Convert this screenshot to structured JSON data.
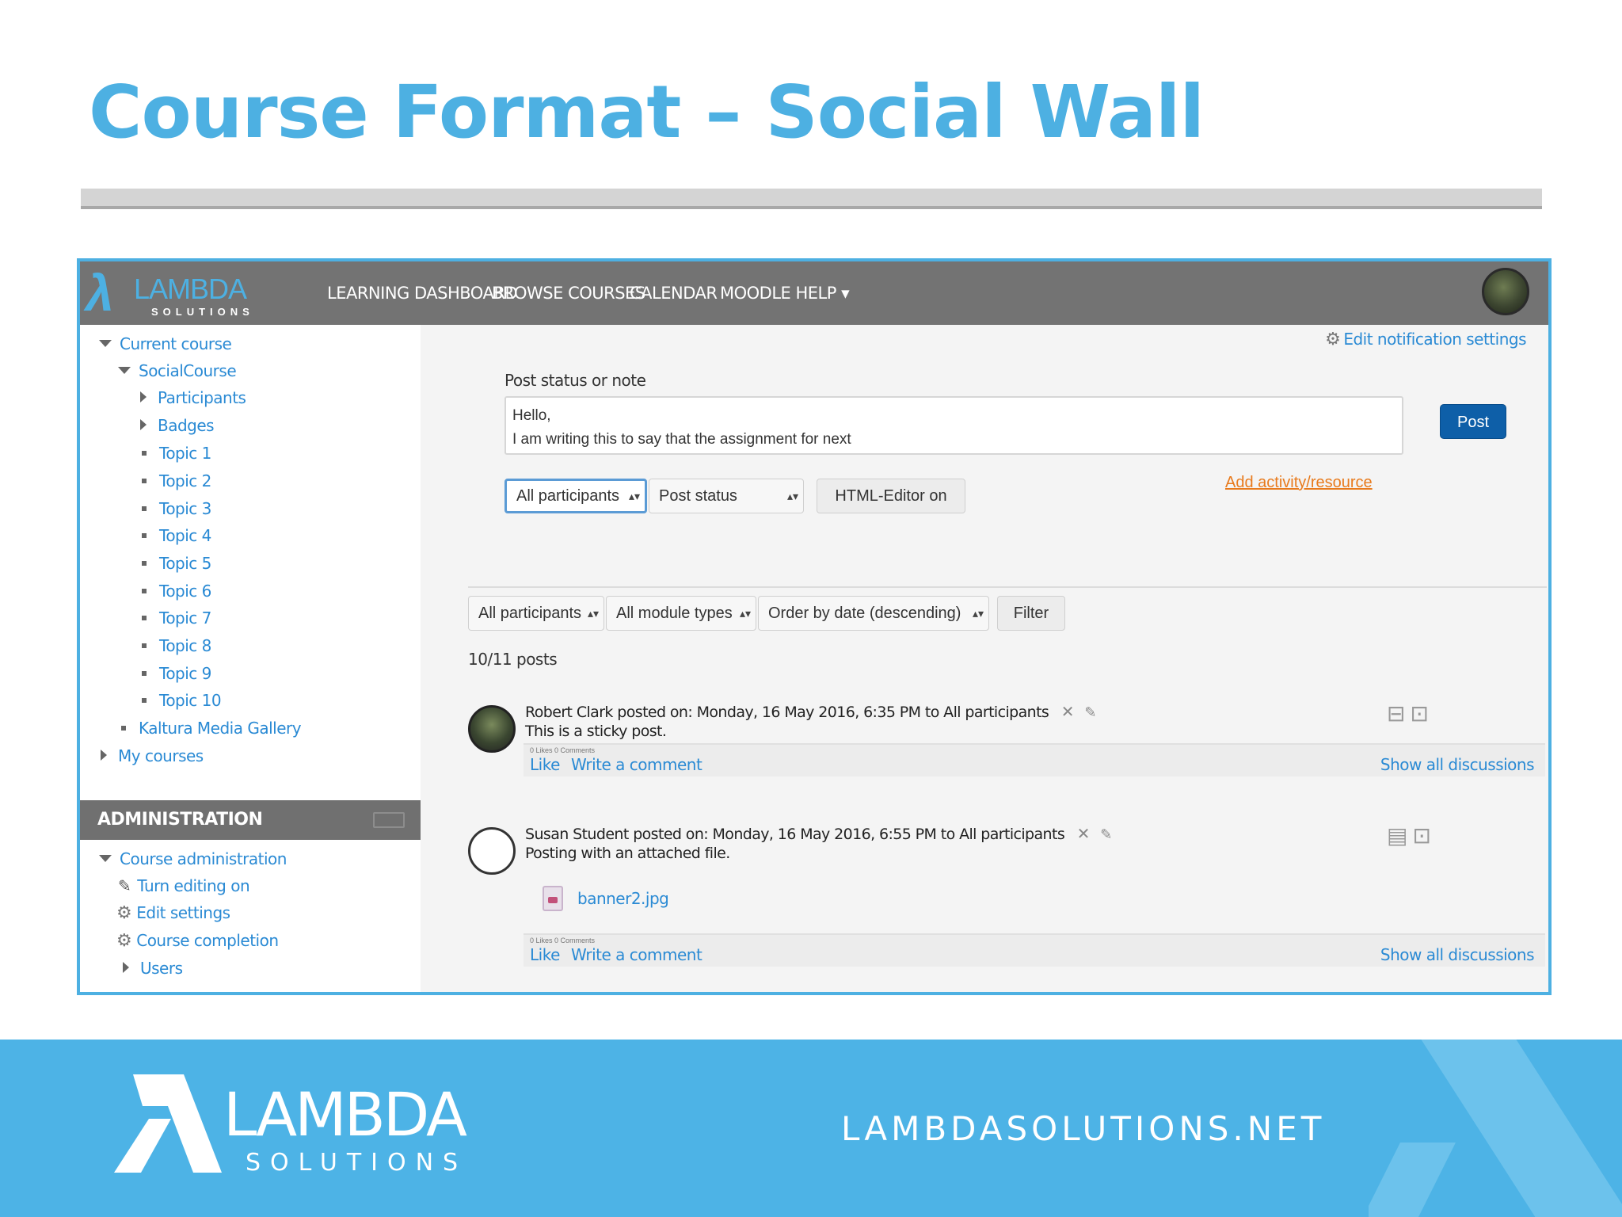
{
  "slide": {
    "title": "Course Format – Social Wall"
  },
  "topnav": {
    "logo_word": "LAMBDA",
    "logo_sub": "SOLUTIONS",
    "links": [
      "LEARNING DASHBOARD",
      "BROWSE COURSES",
      "CALENDAR",
      "MOODLE HELP ▾"
    ]
  },
  "sidebar": {
    "tree": {
      "current_course": "Current course",
      "course_name": "SocialCourse",
      "participants": "Participants",
      "badges": "Badges",
      "topics": [
        "Topic 1",
        "Topic 2",
        "Topic 3",
        "Topic 4",
        "Topic 5",
        "Topic 6",
        "Topic 7",
        "Topic 8",
        "Topic 9",
        "Topic 10"
      ],
      "media_gallery": "Kaltura Media Gallery",
      "my_courses": "My courses"
    },
    "admin": {
      "title": "ADMINISTRATION",
      "course_admin": "Course administration",
      "turn_editing": "Turn editing on",
      "edit_settings": "Edit settings",
      "course_completion": "Course completion",
      "users": "Users"
    }
  },
  "main": {
    "notif_link": "Edit notification settings",
    "post_label": "Post status or note",
    "post_text_line1": "Hello,",
    "post_text_line2": "I am writing this to say that the assignment for next",
    "post_button": "Post",
    "audience_select": "All participants",
    "type_select": "Post status",
    "editor_button": "HTML-Editor on",
    "add_activity": "Add activity/resource",
    "filter": {
      "participants": "All participants",
      "module_types": "All module types",
      "order": "Order by date (descending)",
      "button": "Filter"
    },
    "post_count": "10/11 posts",
    "posts": [
      {
        "author": "Robert Clark",
        "meta": "posted on: Monday, 16 May 2016, 6:35 PM to All participants",
        "body": "This is a sticky post.",
        "counts": "0 Likes   0 Comments",
        "like": "Like",
        "comment": "Write a comment",
        "show_all": "Show all discussions"
      },
      {
        "author": "Susan Student",
        "meta": "posted on: Monday, 16 May 2016, 6:55 PM to All participants",
        "body": "Posting with an attached file.",
        "attachment": "banner2.jpg",
        "counts": "0 Likes   0 Comments",
        "like": "Like",
        "comment": "Write a comment",
        "show_all": "Show all discussions"
      }
    ]
  },
  "footer": {
    "logo_word": "LAMBDA",
    "logo_sub": "SOLUTIONS",
    "url": "LAMBDASOLUTIONS.NET"
  },
  "colors": {
    "accent": "#4db0e2",
    "link": "#2a8ad4",
    "nav_bg": "#737373",
    "post_button": "#0e5fa8",
    "add_link": "#e87a1c",
    "footer_bg": "#4db3e6"
  }
}
